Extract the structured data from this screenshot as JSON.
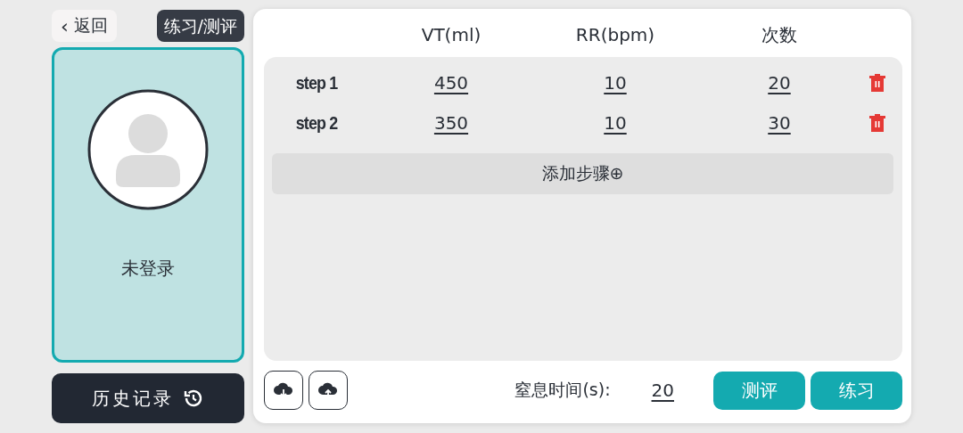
{
  "back_button": {
    "icon": "‹",
    "label": "返回"
  },
  "mode_label": "练习/测评",
  "user_card": {
    "status": "未登录"
  },
  "history_button": {
    "label": "历史记录"
  },
  "table": {
    "columns": [
      "VT(ml)",
      "RR(bpm)",
      "次数"
    ],
    "rows": [
      {
        "step": "step 1",
        "values": [
          "450",
          "10",
          "20"
        ]
      },
      {
        "step": "step 2",
        "values": [
          "350",
          "10",
          "30"
        ]
      }
    ],
    "add_button": "添加步骤⊕"
  },
  "footer": {
    "apnea_label": "窒息时间(s):",
    "apnea_value": "20",
    "buttons": [
      "测评",
      "练习"
    ]
  }
}
